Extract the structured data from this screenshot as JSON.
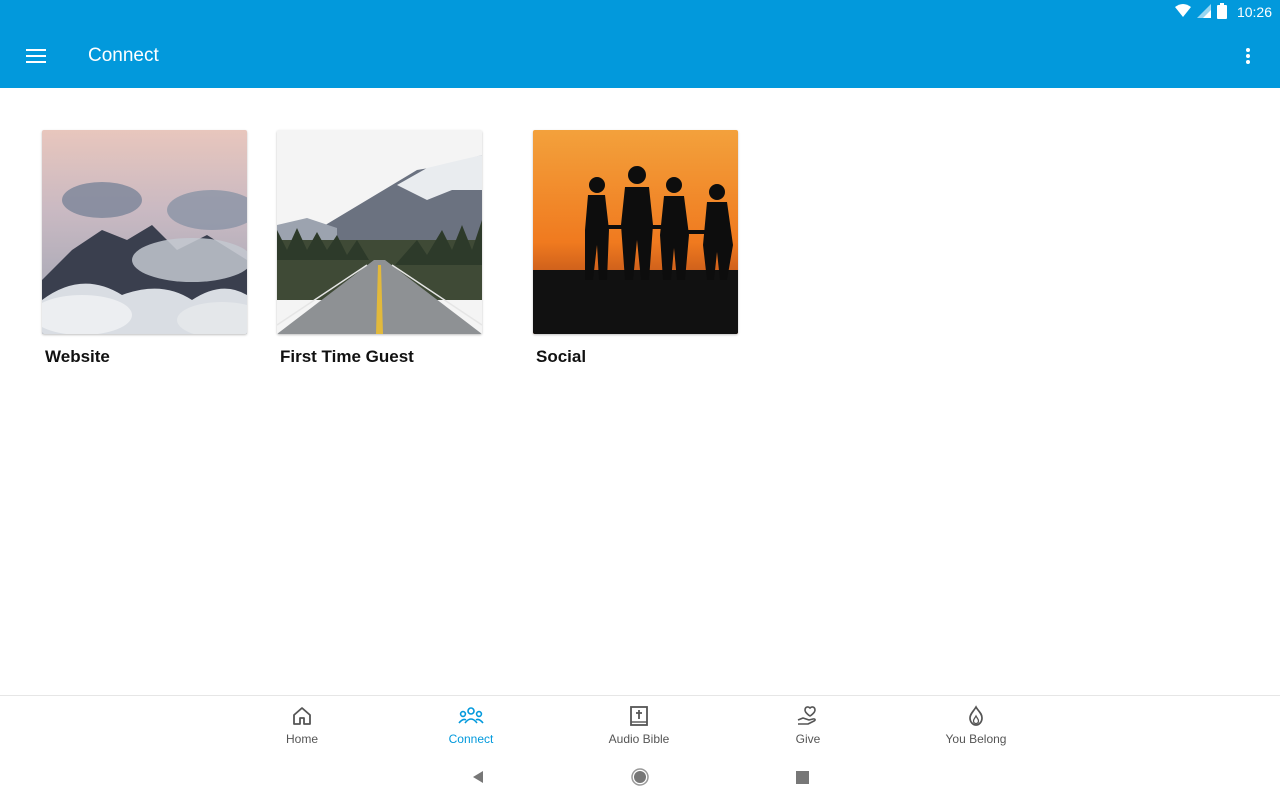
{
  "status_bar": {
    "time": "10:26"
  },
  "app_bar": {
    "title": "Connect",
    "menu_icon": "hamburger-menu-icon",
    "overflow_icon": "more-vert-icon"
  },
  "cards": [
    {
      "label": "Website",
      "image": "misty-mountain-peaks"
    },
    {
      "label": "First Time Guest",
      "image": "road-to-mountains"
    },
    {
      "label": "Social",
      "image": "friends-silhouette-sunset"
    }
  ],
  "bottom_nav": [
    {
      "label": "Home",
      "icon": "home-icon",
      "active": false
    },
    {
      "label": "Connect",
      "icon": "people-icon",
      "active": true
    },
    {
      "label": "Audio Bible",
      "icon": "bible-icon",
      "active": false
    },
    {
      "label": "Give",
      "icon": "give-heart-hand-icon",
      "active": false
    },
    {
      "label": "You Belong",
      "icon": "flame-icon",
      "active": false
    }
  ],
  "colors": {
    "primary": "#0299dc",
    "nav_active": "#0299dc",
    "nav_inactive": "#555555"
  }
}
